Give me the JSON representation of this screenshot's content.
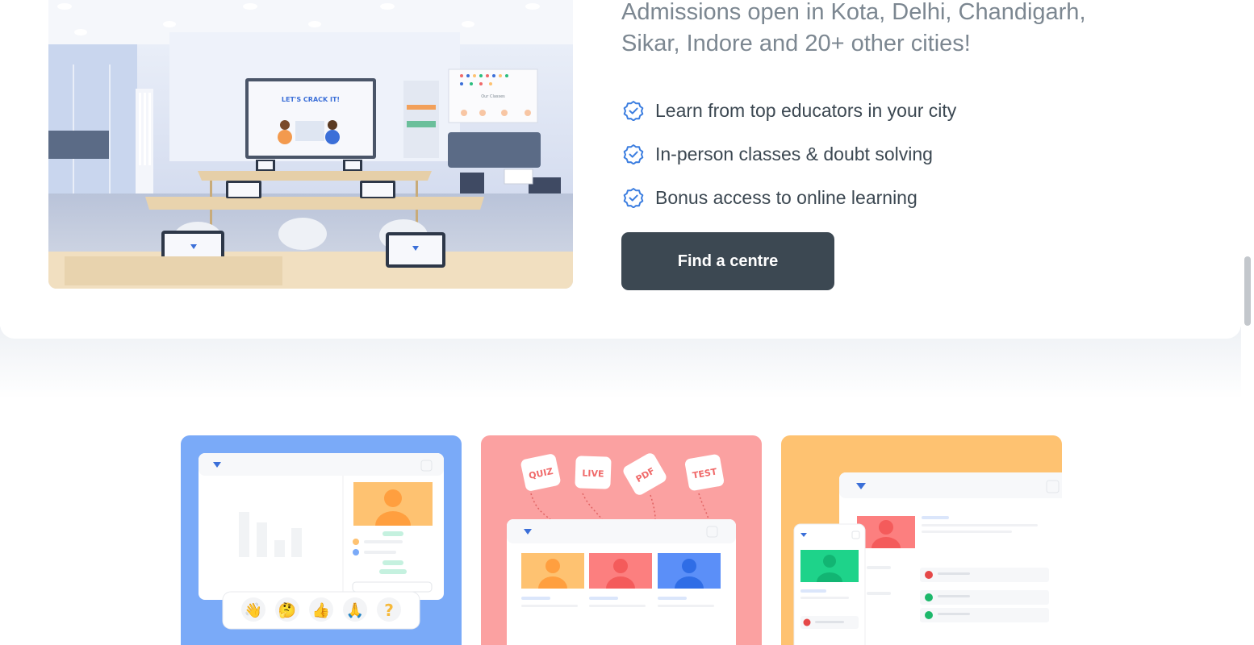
{
  "offline": {
    "headline": "Admissions open in Kota, Delhi, Chandigarh, Sikar, Indore and 20+ other cities!",
    "features": [
      {
        "icon": "check-circle-icon",
        "label": "Learn from top educators in your city"
      },
      {
        "icon": "check-circle-icon",
        "label": "In-person classes & doubt solving"
      },
      {
        "icon": "check-circle-icon",
        "label": "Bonus access to online learning"
      }
    ],
    "cta_label": "Find a centre",
    "photo": {
      "screen_text": "LET'S CRACK IT!",
      "board_caption": "Our Classes"
    }
  },
  "promos": {
    "live": {
      "reactions": [
        "👋",
        "🤔",
        "👍",
        "🙏",
        "?"
      ]
    },
    "formats": {
      "tags": [
        "QUIZ",
        "LIVE",
        "PDF",
        "TEST"
      ]
    }
  },
  "colors": {
    "accent": "#3c4852",
    "check": "#3c7ee0",
    "headline": "#7c8791",
    "promo_blue": "#7aaaf8",
    "promo_pink": "#fba1a1",
    "promo_yellow": "#fec271"
  }
}
